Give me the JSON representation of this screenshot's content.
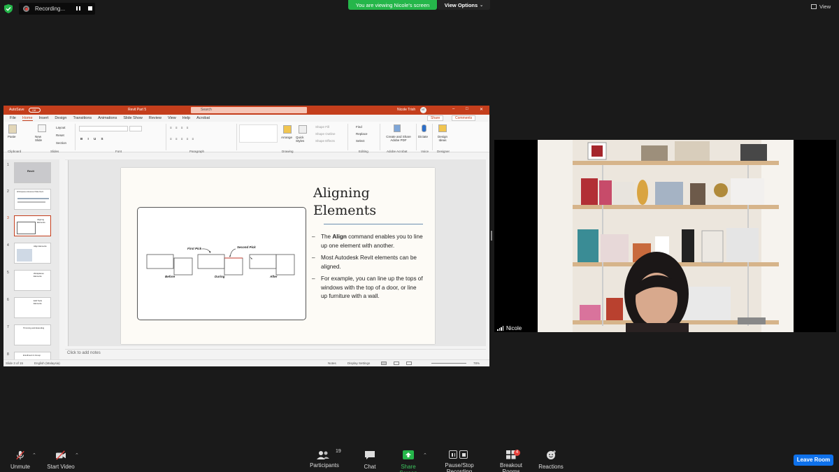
{
  "top_bar": {
    "recording_label": "Recording...",
    "viewing_banner": "You are viewing Nicole's screen",
    "view_options_label": "View Options",
    "view_label": "View"
  },
  "ppt": {
    "autosave_label": "AutoSave",
    "autosave_state": "Off",
    "file_name": "Revit Part 5",
    "search_placeholder": "Search",
    "user_name": "Nicole Trish",
    "user_initials": "NT",
    "tabs": [
      "File",
      "Home",
      "Insert",
      "Design",
      "Transitions",
      "Animations",
      "Slide Show",
      "Review",
      "View",
      "Help",
      "Acrobat"
    ],
    "share_label": "Share",
    "comments_label": "Comments",
    "ribbon": {
      "paste": "Paste",
      "new_slide": "New Slide",
      "layout": "Layout",
      "reset": "Reset",
      "section": "Section",
      "arrange": "Arrange",
      "quick_styles": "Quick Styles",
      "shape_fill": "Shape Fill",
      "shape_outline": "Shape Outline",
      "shape_effects": "Shape Effects",
      "find": "Find",
      "replace": "Replace",
      "select": "Select",
      "create_pdf": "Create and Share Adobe PDF",
      "dictate": "Dictate",
      "design_ideas": "Design Ideas",
      "groups": [
        "Clipboard",
        "Slides",
        "Font",
        "Paragraph",
        "Drawing",
        "Editing",
        "Adobe Acrobat",
        "Voice",
        "Designer"
      ]
    },
    "slide": {
      "title": "Aligning Elements",
      "bullets": [
        {
          "before": "The ",
          "bold": "Align",
          "after": " command enables you to line up one element with another."
        },
        {
          "before": "Most Autodesk Revit elements can be aligned.",
          "bold": "",
          "after": ""
        },
        {
          "before": "For example, you can line up the tops of windows with the top of a door, or line up furniture with a wall.",
          "bold": "",
          "after": ""
        }
      ],
      "diagram": {
        "first_pick": "First Pick",
        "second_pick": "Second Pick",
        "before": "Before",
        "during": "During",
        "after": "After"
      }
    },
    "thumbnails": [
      "1",
      "2",
      "3",
      "4",
      "5",
      "6",
      "7",
      "8"
    ],
    "thumb_titles": [
      "Revit",
      "Workspaces Advanced Slide Deck",
      "Aligning Elements",
      "Align Elements",
      "Workplanes Elements",
      "Edit Tools Elements",
      "Trimming and Extending",
      "Enrollment in Group"
    ],
    "notes_placeholder": "Click to add notes",
    "status": {
      "slide_info": "Slide 3 of 15",
      "language": "English (Malaysia)",
      "notes": "Notes",
      "display_settings": "Display Settings",
      "zoom": "78%"
    }
  },
  "video": {
    "participant_name": "Nicole"
  },
  "toolbar": {
    "unmute": "Unmute",
    "start_video": "Start Video",
    "participants": "Participants",
    "participants_count": "19",
    "chat": "Chat",
    "share_screen": "Share Screen",
    "pause_stop": "Pause/Stop Recording",
    "breakout": "Breakout Rooms",
    "breakout_count": "4",
    "reactions": "Reactions",
    "leave": "Leave Room"
  }
}
